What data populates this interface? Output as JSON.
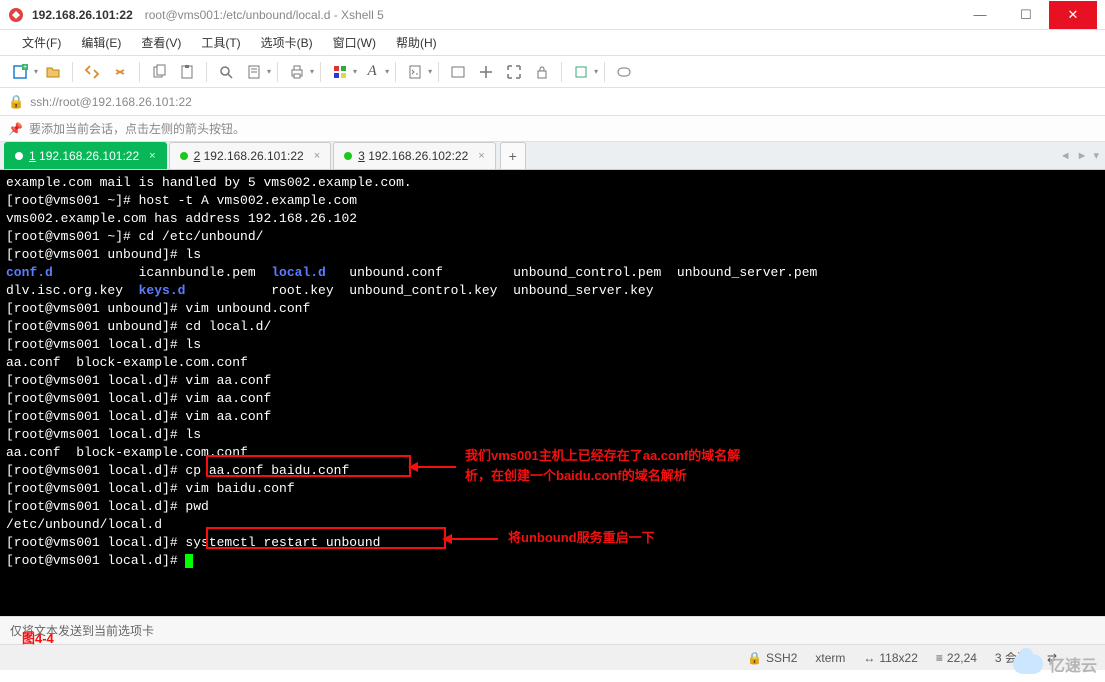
{
  "window": {
    "title_main": "192.168.26.101:22",
    "title_sub": "root@vms001:/etc/unbound/local.d - Xshell 5"
  },
  "menu": {
    "file": "文件(F)",
    "edit": "编辑(E)",
    "view": "查看(V)",
    "tools": "工具(T)",
    "tabs": "选项卡(B)",
    "window": "窗口(W)",
    "help": "帮助(H)"
  },
  "addressbar": {
    "url": "ssh://root@192.168.26.101:22"
  },
  "infobar": {
    "message": "要添加当前会话，点击左侧的箭头按钮。"
  },
  "tabs": [
    {
      "num": "1",
      "label": "192.168.26.101:22",
      "active": true
    },
    {
      "num": "2",
      "label": "192.168.26.101:22",
      "active": false
    },
    {
      "num": "3",
      "label": "192.168.26.102:22",
      "active": false
    }
  ],
  "terminal": {
    "lines": [
      {
        "t": "example.com mail is handled by 5 vms002.example.com."
      },
      {
        "t": "[root@vms001 ~]# host -t A vms002.example.com"
      },
      {
        "t": "vms002.example.com has address 192.168.26.102"
      },
      {
        "t": "[root@vms001 ~]# cd /etc/unbound/"
      },
      {
        "t": "[root@vms001 unbound]# ls"
      },
      {
        "t": "conf.d           icannbundle.pem  local.d   unbound.conf         unbound_control.pem  unbound_server.pem",
        "dirs": [
          "conf.d",
          "local.d"
        ]
      },
      {
        "t": "dlv.isc.org.key  keys.d           root.key  unbound_control.key  unbound_server.key",
        "dirs": [
          "keys.d"
        ]
      },
      {
        "t": "[root@vms001 unbound]# vim unbound.conf"
      },
      {
        "t": "[root@vms001 unbound]# cd local.d/"
      },
      {
        "t": "[root@vms001 local.d]# ls"
      },
      {
        "t": "aa.conf  block-example.com.conf"
      },
      {
        "t": "[root@vms001 local.d]# vim aa.conf"
      },
      {
        "t": "[root@vms001 local.d]# vim aa.conf"
      },
      {
        "t": "[root@vms001 local.d]# vim aa.conf"
      },
      {
        "t": "[root@vms001 local.d]# ls"
      },
      {
        "t": "aa.conf  block-example.com.conf"
      },
      {
        "t": "[root@vms001 local.d]# cp aa.conf baidu.conf"
      },
      {
        "t": "[root@vms001 local.d]# vim baidu.conf"
      },
      {
        "t": "[root@vms001 local.d]# pwd"
      },
      {
        "t": "/etc/unbound/local.d"
      },
      {
        "t": "[root@vms001 local.d]# systemctl restart unbound"
      },
      {
        "t": "[root@vms001 local.d]# ",
        "cursor": true
      }
    ]
  },
  "annotations": {
    "note1_line1": "我们vms001主机上已经存在了aa.conf的域名解",
    "note1_line2": "析，在创建一个baidu.conf的域名解析",
    "note2": "将unbound服务重启一下",
    "figure": "图4-4"
  },
  "sendbar": {
    "text": "仅将文本发送到当前选项卡"
  },
  "statusbar": {
    "proto": "SSH2",
    "term": "xterm",
    "size": "118x22",
    "pos": "22,24",
    "sessions": "3 会话"
  },
  "watermark": {
    "text": "亿速云"
  },
  "icons": {
    "minimize": "—",
    "maximize": "☐",
    "close": "✕",
    "lock": "🔒",
    "pin": "📌",
    "plus": "+",
    "tab_close": "×",
    "arrows": "⇄",
    "proto_icon": "🔒",
    "size_icon": "↔",
    "pos_icon": "≡",
    "left": "◄",
    "right": "►",
    "down": "▾"
  }
}
